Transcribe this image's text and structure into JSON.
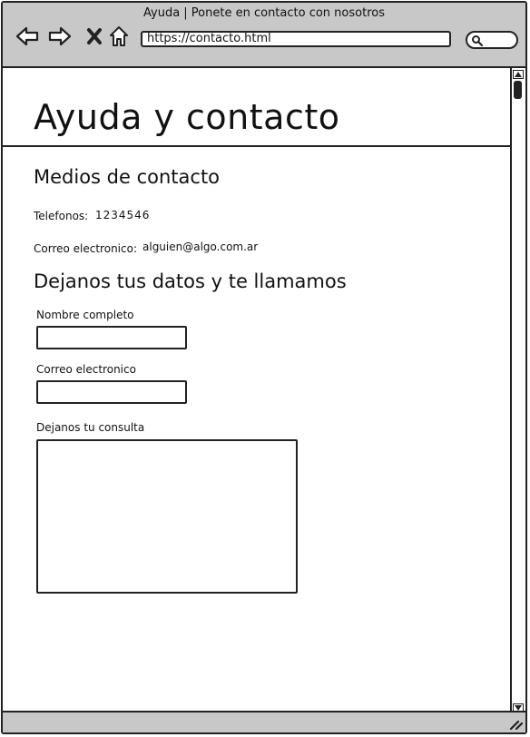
{
  "window": {
    "title": "Ayuda | Ponete en contacto con nosotros",
    "url": "https://contacto.html"
  },
  "page": {
    "heading": "Ayuda y contacto",
    "contact_section": {
      "title": "Medios de contacto",
      "phone_label": "Telefonos:",
      "phone_value": "1234546",
      "email_label": "Correo electronico:",
      "email_value": "alguien@algo.com.ar"
    },
    "form_section": {
      "title": "Dejanos tus datos y te llamamos",
      "name_label": "Nombre completo",
      "name_value": "",
      "email_label": "Correo electronico",
      "email_value": "",
      "message_label": "Dejanos tu consulta",
      "message_value": ""
    }
  },
  "icons": {
    "back": "back-arrow-icon",
    "forward": "forward-arrow-icon",
    "stop": "close-x-icon",
    "home": "home-icon",
    "search": "search-icon",
    "resize": "resize-grip-icon"
  }
}
